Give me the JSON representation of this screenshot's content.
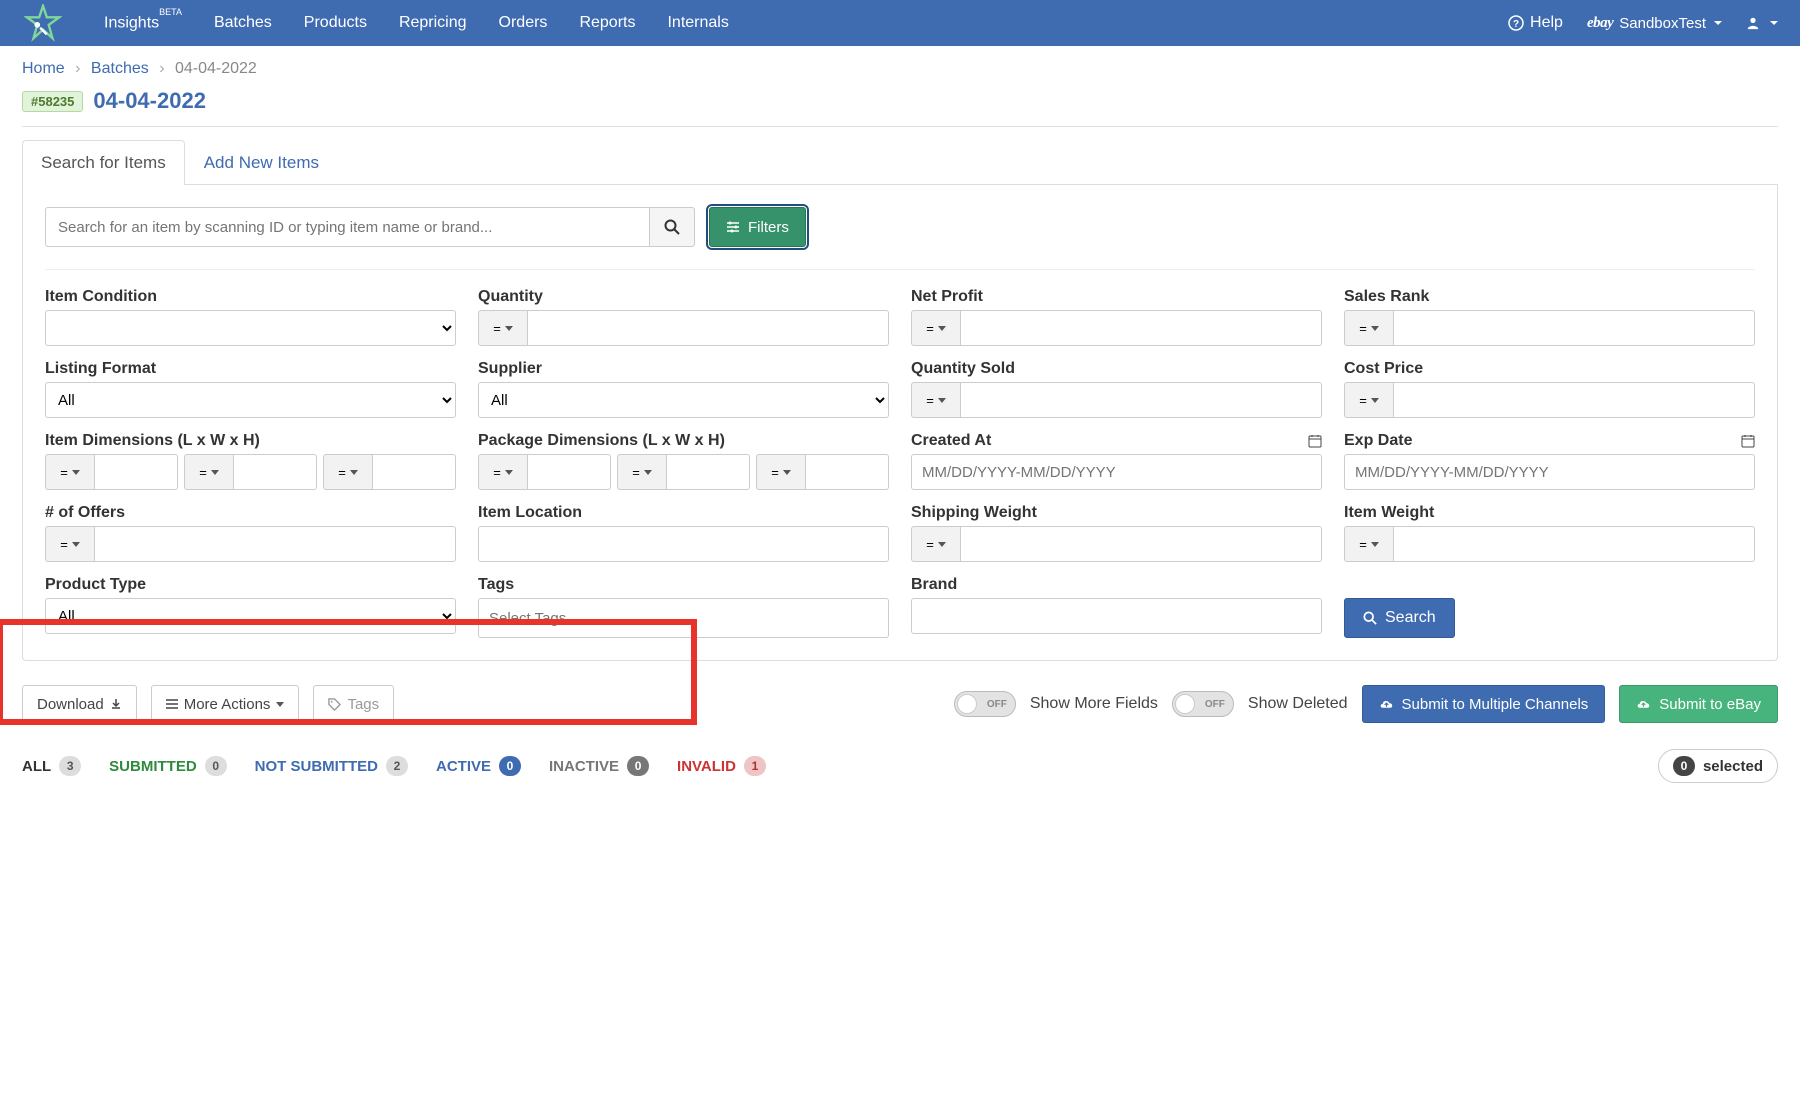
{
  "nav": {
    "items": [
      "Insights",
      "Batches",
      "Products",
      "Repricing",
      "Orders",
      "Reports",
      "Internals"
    ],
    "insights_badge": "BETA",
    "help": "Help",
    "brand_prefix": "ebay",
    "user": "SandboxTest"
  },
  "breadcrumb": {
    "home": "Home",
    "batches": "Batches",
    "current": "04-04-2022"
  },
  "batch": {
    "id": "#58235",
    "title": "04-04-2022"
  },
  "tabs": {
    "search": "Search for Items",
    "add": "Add New Items"
  },
  "search": {
    "placeholder": "Search for an item by scanning ID or typing item name or brand...",
    "filters_btn": "Filters"
  },
  "filters": {
    "item_condition": "Item Condition",
    "quantity": "Quantity",
    "net_profit": "Net Profit",
    "sales_rank": "Sales Rank",
    "listing_format": "Listing Format",
    "supplier": "Supplier",
    "quantity_sold": "Quantity Sold",
    "cost_price": "Cost Price",
    "item_dimensions": "Item Dimensions (L x W x H)",
    "package_dimensions": "Package Dimensions (L x W x H)",
    "created_at": "Created At",
    "exp_date": "Exp Date",
    "offers": "# of Offers",
    "item_location": "Item Location",
    "shipping_weight": "Shipping Weight",
    "item_weight": "Item Weight",
    "product_type": "Product Type",
    "tags": "Tags",
    "brand": "Brand",
    "all_option": "All",
    "date_placeholder": "MM/DD/YYYY-MM/DD/YYYY",
    "tags_placeholder": "Select Tags",
    "eq_op": "=",
    "search_btn": "Search"
  },
  "bottom": {
    "download": "Download",
    "more_actions": "More Actions",
    "tags": "Tags",
    "off": "OFF",
    "show_more_fields": "Show More Fields",
    "show_deleted": "Show Deleted",
    "submit_multi": "Submit to Multiple Channels",
    "submit_ebay": "Submit to eBay"
  },
  "status": {
    "all": {
      "label": "ALL",
      "count": "3",
      "color": "#333"
    },
    "submitted": {
      "label": "SUBMITTED",
      "count": "0",
      "color": "#2e8b3d"
    },
    "not_submitted": {
      "label": "NOT SUBMITTED",
      "count": "2",
      "color": "#3f6bb0"
    },
    "active": {
      "label": "ACTIVE",
      "count": "0",
      "color": "#3f6bb0",
      "badge_bg": "#3f6bb0",
      "badge_fg": "#fff"
    },
    "inactive": {
      "label": "INACTIVE",
      "count": "0",
      "color": "#777"
    },
    "invalid": {
      "label": "INVALID",
      "count": "1",
      "color": "#c33",
      "badge_bg": "#e8b4b4"
    },
    "selected": {
      "num": "0",
      "label": "selected"
    }
  }
}
